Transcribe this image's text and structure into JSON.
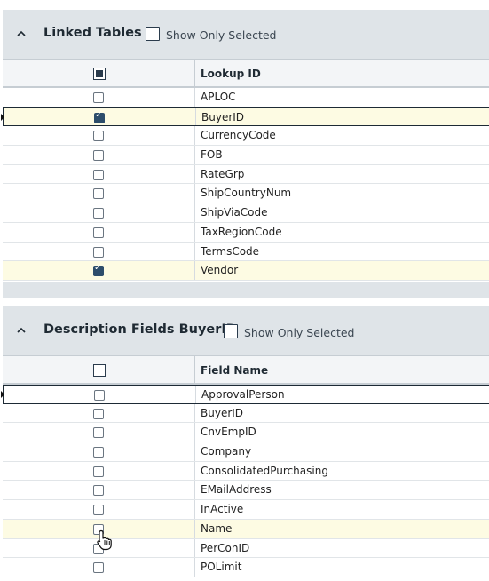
{
  "linked_tables": {
    "title": "Linked Tables",
    "show_only_selected": "Show Only Selected",
    "column_header": "Lookup ID",
    "rows": [
      {
        "label": "APLOC",
        "checked": false
      },
      {
        "label": "BuyerID",
        "checked": true,
        "active": true
      },
      {
        "label": "CurrencyCode",
        "checked": false
      },
      {
        "label": "FOB",
        "checked": false
      },
      {
        "label": "RateGrp",
        "checked": false
      },
      {
        "label": "ShipCountryNum",
        "checked": false
      },
      {
        "label": "ShipViaCode",
        "checked": false
      },
      {
        "label": "TaxRegionCode",
        "checked": false
      },
      {
        "label": "TermsCode",
        "checked": false
      },
      {
        "label": "Vendor",
        "checked": true
      }
    ]
  },
  "description_fields": {
    "title": "Description Fields BuyerID",
    "show_only_selected": "Show Only Selected",
    "column_header": "Field Name",
    "rows": [
      {
        "label": "ApprovalPerson",
        "checked": false,
        "active": true
      },
      {
        "label": "BuyerID",
        "checked": false
      },
      {
        "label": "CnvEmpID",
        "checked": false
      },
      {
        "label": "Company",
        "checked": false
      },
      {
        "label": "ConsolidatedPurchasing",
        "checked": false
      },
      {
        "label": "EMailAddress",
        "checked": false
      },
      {
        "label": "InActive",
        "checked": false
      },
      {
        "label": "Name",
        "checked": false,
        "hover": true
      },
      {
        "label": "PerConID",
        "checked": false
      },
      {
        "label": "POLimit",
        "checked": false
      }
    ]
  },
  "icons": {
    "collapse": "chevron-up-icon",
    "cursor": "hand-pointer-icon",
    "row_marker": "row-indicator-icon"
  }
}
